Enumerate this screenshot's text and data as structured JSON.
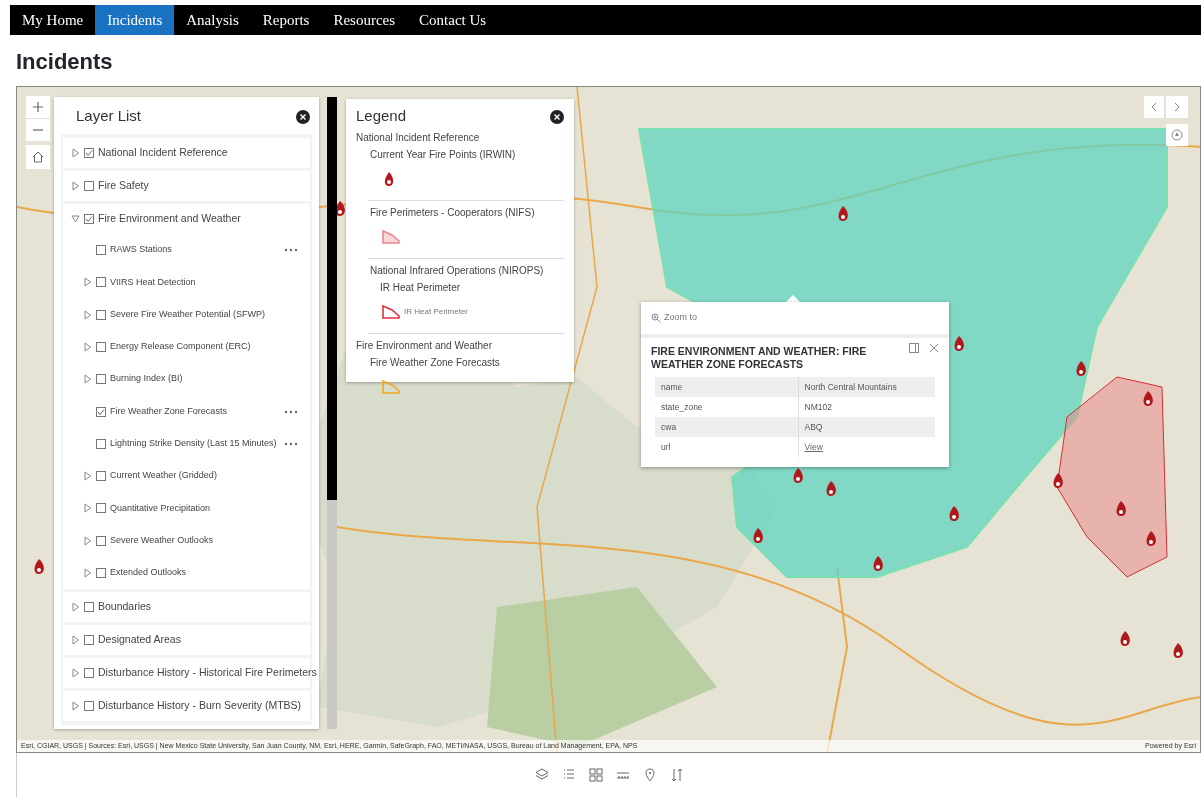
{
  "nav": [
    {
      "label": "My Home",
      "selected": false
    },
    {
      "label": "Incidents",
      "selected": true
    },
    {
      "label": "Analysis",
      "selected": false
    },
    {
      "label": "Reports",
      "selected": false
    },
    {
      "label": "Resources",
      "selected": false
    },
    {
      "label": "Contact Us",
      "selected": false
    }
  ],
  "page_title": "Incidents",
  "layer_list": {
    "title": "Layer List",
    "layers": [
      {
        "label": "National Incident Reference",
        "checked": true,
        "expandable": true,
        "expanded": false
      },
      {
        "label": "Fire Safety",
        "checked": false,
        "expandable": true,
        "expanded": false
      },
      {
        "label": "Fire Environment and Weather",
        "checked": true,
        "expandable": true,
        "expanded": true,
        "children": [
          {
            "label": "RAWS Stations",
            "checked": false,
            "expandable": false,
            "menu": true
          },
          {
            "label": "VIIRS Heat Detection",
            "checked": false,
            "expandable": true,
            "menu": false
          },
          {
            "label": "Severe Fire Weather Potential (SFWP)",
            "checked": false,
            "expandable": true,
            "menu": false
          },
          {
            "label": "Energy Release Component (ERC)",
            "checked": false,
            "expandable": true,
            "menu": false
          },
          {
            "label": "Burning Index (BI)",
            "checked": false,
            "expandable": true,
            "menu": false
          },
          {
            "label": "Fire Weather Zone Forecasts",
            "checked": true,
            "expandable": false,
            "menu": true
          },
          {
            "label": "Lightning Strike Density (Last 15 Minutes)",
            "checked": false,
            "expandable": false,
            "menu": true
          },
          {
            "label": "Current Weather (Gridded)",
            "checked": false,
            "expandable": true,
            "menu": false
          },
          {
            "label": "Quantitative Precipitation",
            "checked": false,
            "expandable": true,
            "menu": false
          },
          {
            "label": "Severe Weather Outlooks",
            "checked": false,
            "expandable": true,
            "menu": false
          },
          {
            "label": "Extended Outlooks",
            "checked": false,
            "expandable": true,
            "menu": false
          }
        ]
      },
      {
        "label": "Boundaries",
        "checked": false,
        "expandable": true,
        "expanded": false
      },
      {
        "label": "Designated Areas",
        "checked": false,
        "expandable": true,
        "expanded": false
      },
      {
        "label": "Disturbance History - Historical Fire Perimeters",
        "checked": false,
        "expandable": true,
        "expanded": false
      },
      {
        "label": "Disturbance History - Burn Severity (MTBS)",
        "checked": false,
        "expandable": true,
        "expanded": false
      }
    ]
  },
  "legend": {
    "title": "Legend",
    "entries": [
      {
        "kind": "group",
        "label": "National Incident Reference"
      },
      {
        "kind": "layer",
        "label": "Current Year Fire Points (IRWIN)"
      },
      {
        "kind": "fire_symbol"
      },
      {
        "kind": "divider"
      },
      {
        "kind": "layer",
        "label": "Fire Perimeters - Cooperators (NIFS)"
      },
      {
        "kind": "fill_symbol",
        "color": "#e8868f"
      },
      {
        "kind": "divider"
      },
      {
        "kind": "layer",
        "label": "National Infrared Operations (NIROPS)"
      },
      {
        "kind": "sublayer",
        "label": "IR Heat Perimeter"
      },
      {
        "kind": "outline_symbol",
        "color": "#e0303e",
        "caption": "IR Heat Perimeter"
      },
      {
        "kind": "divider"
      },
      {
        "kind": "group",
        "label": "Fire Environment and Weather"
      },
      {
        "kind": "layer",
        "label": "Fire Weather Zone Forecasts"
      },
      {
        "kind": "outline_symbol",
        "color": "#f0a81c"
      }
    ]
  },
  "popup": {
    "action": "Zoom to",
    "title": "FIRE ENVIRONMENT AND WEATHER: FIRE WEATHER ZONE FORECASTS",
    "rows": [
      {
        "field": "name",
        "value": "North Central Mountains"
      },
      {
        "field": "state_zone",
        "value": "NM102"
      },
      {
        "field": "cwa",
        "value": "ABQ"
      },
      {
        "field": "url",
        "value": "View",
        "link": true
      }
    ]
  },
  "map": {
    "attribution": "Esri, CGIAR, USGS | Sources: Esri, USGS | New Mexico State University, San Juan County, NM, Esri, HERE, Garmin, SafeGraph, FAO, METI/NASA, USGS, Bureau of Land Management, EPA, NPS",
    "powered_by": "Powered by Esri"
  }
}
